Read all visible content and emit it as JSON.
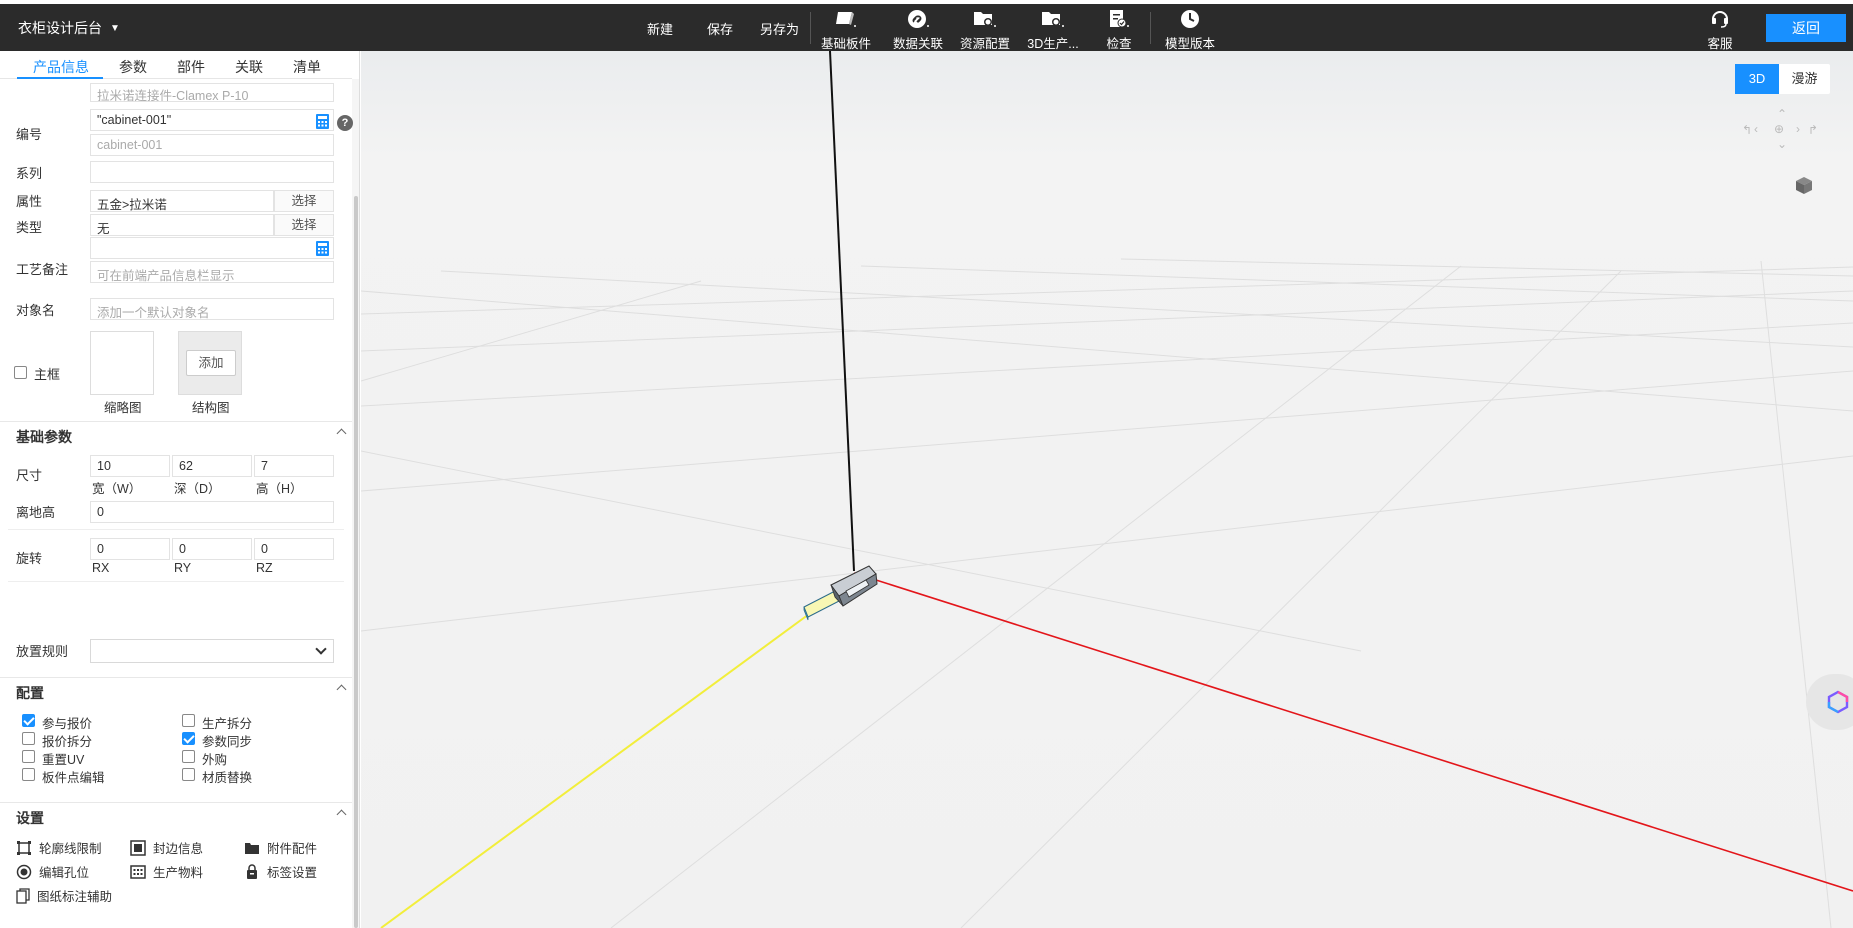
{
  "app": {
    "title": "衣柜设计后台"
  },
  "toolbar": {
    "new": "新建",
    "save": "保存",
    "save_as": "另存为",
    "base_board": "基础板件",
    "data_link": "数据关联",
    "resource_config": "资源配置",
    "production_3d": "3D生产...",
    "check": "检查",
    "model_version": "模型版本",
    "service": "客服",
    "back": "返回"
  },
  "tabs": [
    "产品信息",
    "参数",
    "部件",
    "关联",
    "清单"
  ],
  "product_info": {
    "name_value": "拉米诺连接件-Clamex P-10",
    "code_label": "编号",
    "code_value": "\"cabinet-001\"",
    "code_result": "cabinet-001",
    "series_label": "系列",
    "series_value": "",
    "attribute_label": "属性",
    "attribute_value": "五金>拉米诺",
    "attribute_btn": "选择",
    "type_label": "类型",
    "type_value": "无",
    "type_btn": "选择",
    "craft_note_label": "工艺备注",
    "craft_note_value": "",
    "craft_note_placeholder": "可在前端产品信息栏显示",
    "object_name_label": "对象名",
    "object_name_placeholder": "添加一个默认对象名",
    "main_frame_label": "主框",
    "thumbnail_label": "缩略图",
    "structure_label": "结构图",
    "add_btn": "添加"
  },
  "basic_params": {
    "title": "基础参数",
    "size_label": "尺寸",
    "width": "10",
    "width_label": "宽（W）",
    "depth": "62",
    "depth_label": "深（D）",
    "height": "7",
    "height_label": "高（H）",
    "ground_label": "离地高",
    "ground_value": "0",
    "rotation_label": "旋转",
    "rx": "0",
    "rx_label": "RX",
    "ry": "0",
    "ry_label": "RY",
    "rz": "0",
    "rz_label": "RZ",
    "placement_label": "放置规则",
    "placement_value": ""
  },
  "config": {
    "title": "配置",
    "items": [
      {
        "label": "参与报价",
        "checked": true
      },
      {
        "label": "生产拆分",
        "checked": false
      },
      {
        "label": "报价拆分",
        "checked": false
      },
      {
        "label": "参数同步",
        "checked": true
      },
      {
        "label": "重置UV",
        "checked": false
      },
      {
        "label": "外购",
        "checked": false
      },
      {
        "label": "板件点编辑",
        "checked": false
      },
      {
        "label": "材质替换",
        "checked": false
      }
    ]
  },
  "settings": {
    "title": "设置",
    "items": [
      "轮廓线限制",
      "封边信息",
      "附件配件",
      "编辑孔位",
      "生产物料",
      "标签设置",
      "图纸标注辅助"
    ]
  },
  "viewport": {
    "mode_3d": "3D",
    "mode_roam": "漫游",
    "colors": {
      "y_axis": "#f2ee3b",
      "x_axis": "#e3151a",
      "z_axis": "#111111",
      "accent": "#1890ff"
    }
  }
}
